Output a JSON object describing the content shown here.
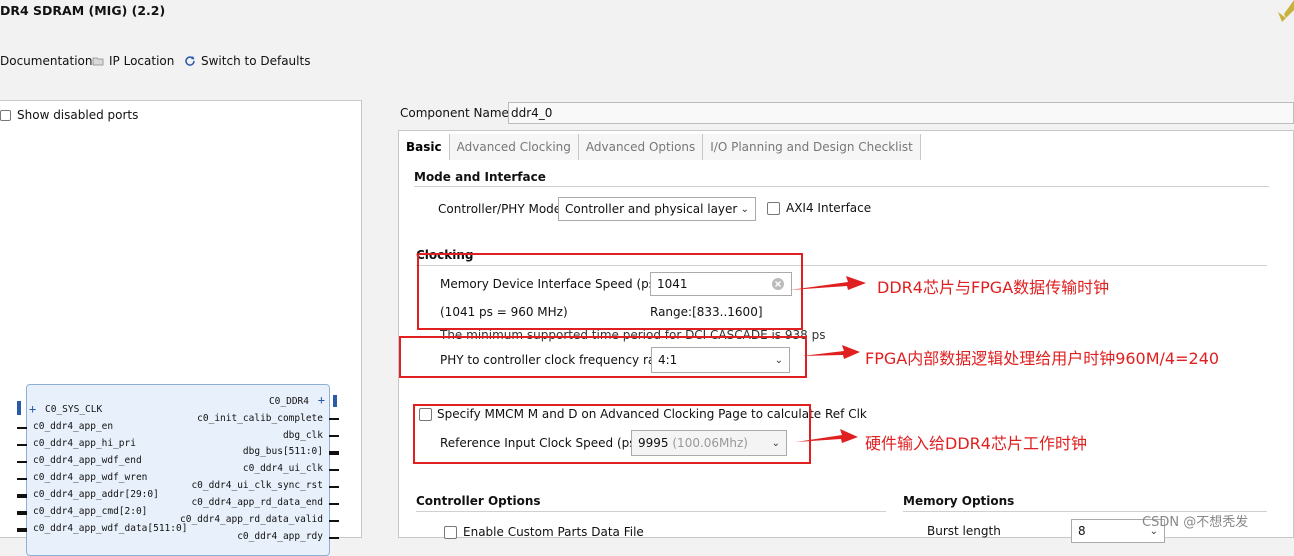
{
  "window": {
    "title": "DR4 SDRAM (MIG) (2.2)"
  },
  "toolbar": {
    "documentation": "Documentation",
    "ip_location": "IP Location",
    "switch_defaults": "Switch to Defaults"
  },
  "left": {
    "show_disabled_ports": "Show disabled ports",
    "ip_block": {
      "left_bus_label": "C0_SYS_CLK",
      "right_bus_label": "C0_DDR4",
      "left_ports": [
        "c0_ddr4_app_en",
        "c0_ddr4_app_hi_pri",
        "c0_ddr4_app_wdf_end",
        "c0_ddr4_app_wdf_wren",
        "c0_ddr4_app_addr[29:0]",
        "c0_ddr4_app_cmd[2:0]",
        "c0_ddr4_app_wdf_data[511:0]"
      ],
      "right_ports": [
        "c0_init_calib_complete",
        "dbg_clk",
        "dbg_bus[511:0]",
        "c0_ddr4_ui_clk",
        "c0_ddr4_ui_clk_sync_rst",
        "c0_ddr4_app_rd_data_end",
        "c0_ddr4_app_rd_data_valid",
        "c0_ddr4_app_rdy"
      ]
    }
  },
  "component": {
    "label": "Component Name",
    "value": "ddr4_0"
  },
  "tabs": [
    "Basic",
    "Advanced Clocking",
    "Advanced Options",
    "I/O Planning and Design Checklist"
  ],
  "mode": {
    "section": "Mode and Interface",
    "phy_mode_label": "Controller/PHY Mode",
    "phy_mode_value": "Controller and physical layer",
    "axi4_label": "AXI4 Interface"
  },
  "clocking": {
    "section": "Clocking",
    "speed_label": "Memory Device Interface Speed (ps)",
    "speed_value": "1041",
    "speed_note": "(1041 ps = 960 MHz)",
    "range": "Range:[833..1600]",
    "min_note": "The minimum supported time period for DCI CASCADE is 938 ps",
    "ratio_label": "PHY to controller clock frequency ratio",
    "ratio_value": "4:1",
    "mmcm_label": "Specify MMCM M and D on Advanced Clocking Page to calculate Ref Clk",
    "ref_label": "Reference Input Clock Speed (ps)",
    "ref_value": "9995",
    "ref_value_note": "(100.06Mhz)"
  },
  "controller": {
    "section": "Controller Options",
    "custom_parts": "Enable Custom Parts Data File"
  },
  "memory": {
    "section": "Memory Options",
    "burst_label": "Burst length",
    "burst_value": "8"
  },
  "annotations": {
    "a1": "DDR4芯片与FPGA数据传输时钟",
    "a2": "FPGA内部数据逻辑处理给用户时钟960M/4=240",
    "a3": "硬件输入给DDR4芯片工作时钟"
  },
  "watermark": "CSDN @不想秃发",
  "colors": {
    "annotation": "#e02020",
    "ip_block": "#e8f1fb"
  }
}
